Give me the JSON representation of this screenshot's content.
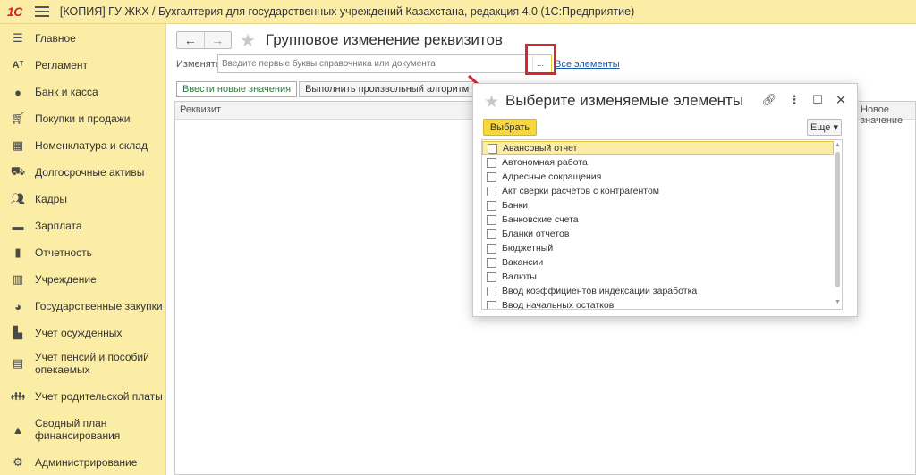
{
  "titlebar": {
    "logo": "1С",
    "title": "[КОПИЯ] ГУ ЖКХ / Бухгалтерия для государственных учреждений Казахстана, редакция 4.0  (1С:Предприятие)"
  },
  "sidebar": {
    "items": [
      {
        "label": "Главное",
        "icon": "list-icon"
      },
      {
        "label": "Регламент",
        "icon": "regulation-icon"
      },
      {
        "label": "Банк и касса",
        "icon": "coin-icon"
      },
      {
        "label": "Покупки и продажи",
        "icon": "cart-icon"
      },
      {
        "label": "Номенклатура и склад",
        "icon": "grid-icon"
      },
      {
        "label": "Долгосрочные активы",
        "icon": "truck-icon"
      },
      {
        "label": "Кадры",
        "icon": "people-icon"
      },
      {
        "label": "Зарплата",
        "icon": "salary-icon"
      },
      {
        "label": "Отчетность",
        "icon": "bar-chart-icon"
      },
      {
        "label": "Учреждение",
        "icon": "building-icon"
      },
      {
        "label": "Государственные закупки",
        "icon": "procurement-icon"
      },
      {
        "label": "Учет осужденных",
        "icon": "person-group-icon"
      },
      {
        "label": "Учет пенсий и пособий опекаемых",
        "icon": "pension-icon"
      },
      {
        "label": "Учет родительской платы",
        "icon": "family-icon"
      },
      {
        "label": "Сводный план финансирования",
        "icon": "plan-icon"
      },
      {
        "label": "Администрирование",
        "icon": "gear-icon"
      }
    ]
  },
  "main": {
    "title": "Групповое изменение реквизитов",
    "change_label": "Изменять:",
    "change_placeholder": "Введите первые буквы справочника или документа",
    "dots_label": "...",
    "all_link": "Все элементы",
    "tabs": [
      "Ввести новые значения",
      "Выполнить произвольный алгоритм"
    ],
    "grid_columns": [
      "Реквизит",
      "Новое значение"
    ]
  },
  "dialog": {
    "title": "Выберите изменяемые элементы",
    "choose_label": "Выбрать",
    "more_label": "Еще ▾",
    "items": [
      "Авансовый отчет",
      "Автономная работа",
      "Адресные сокращения",
      "Акт сверки расчетов с контрагентом",
      "Банки",
      "Банковские счета",
      "Бланки отчетов",
      "Бюджетный",
      "Вакансии",
      "Валюты",
      "Ввод коэффициентов индексации заработка",
      "Ввод начальных остатков"
    ]
  },
  "colors": {
    "panel_yellow": "#fbeda6",
    "button_yellow": "#f6d73d",
    "highlight_red": "#d8262d",
    "link_blue": "#1c5ba4"
  }
}
